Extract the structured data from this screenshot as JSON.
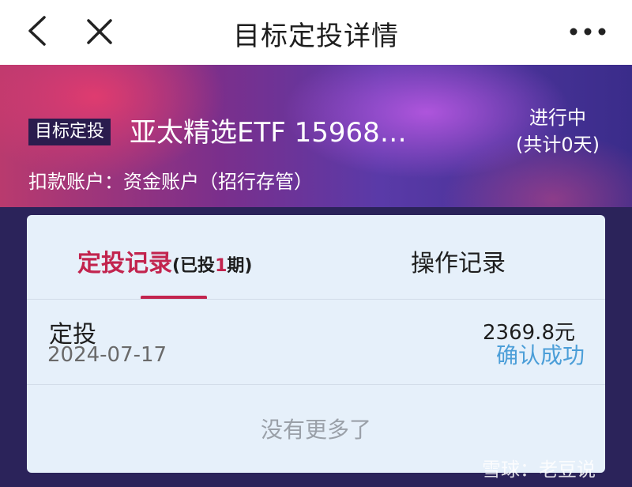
{
  "header": {
    "title": "目标定投详情"
  },
  "plan": {
    "tag": "目标定投",
    "fund_name": "亚太精选ETF 15968…",
    "status": "进行中",
    "days": "(共计0天)",
    "account": "扣款账户：资金账户（招行存管）"
  },
  "tabs": {
    "records_label": "定投记录",
    "records_sub_prefix": "(已投",
    "records_sub_count": "1",
    "records_sub_suffix": "期)",
    "ops_label": "操作记录"
  },
  "records": [
    {
      "type": "定投",
      "date": "2024-07-17",
      "amount": "2369.8元",
      "status": "确认成功"
    }
  ],
  "footer": {
    "no_more": "没有更多了"
  },
  "watermark": {
    "text": "雪球：老豆说"
  },
  "colors": {
    "accent": "#c2244e",
    "status_success": "#4b9ed8",
    "card_bg": "#e6f0fa"
  },
  "icons": [
    "back-icon",
    "close-icon",
    "more-icon"
  ]
}
